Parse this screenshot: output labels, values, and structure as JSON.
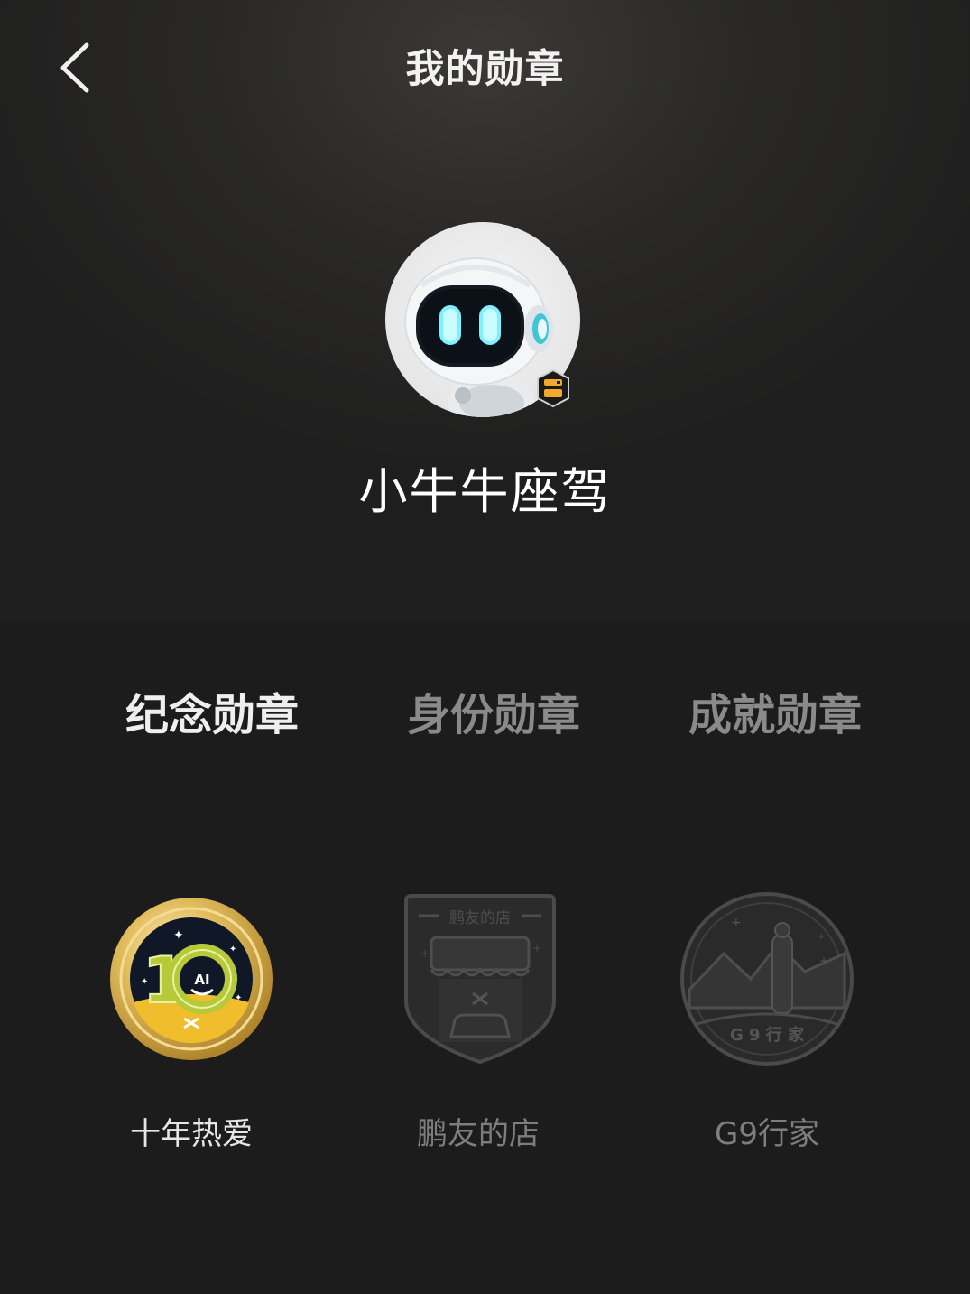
{
  "header": {
    "title": "我的勋章"
  },
  "profile": {
    "nickname": "小牛牛座驾"
  },
  "tabs": [
    {
      "label": "纪念勋章",
      "active": true
    },
    {
      "label": "身份勋章",
      "active": false
    },
    {
      "label": "成就勋章",
      "active": false
    }
  ],
  "medals": [
    {
      "name": "十年热爱",
      "earned": true,
      "badge_text": "AI"
    },
    {
      "name": "鹏友的店",
      "earned": false,
      "badge_text": "鹏友的店"
    },
    {
      "name": "G9行家",
      "earned": false,
      "badge_text": "G 9 行 家"
    }
  ],
  "colors": {
    "background": "#1c1c1c",
    "active_tab": "#efefef",
    "inactive_tab": "#8a8a8a",
    "gold": "#d8b254",
    "robot_eye": "#7ff0ff"
  }
}
